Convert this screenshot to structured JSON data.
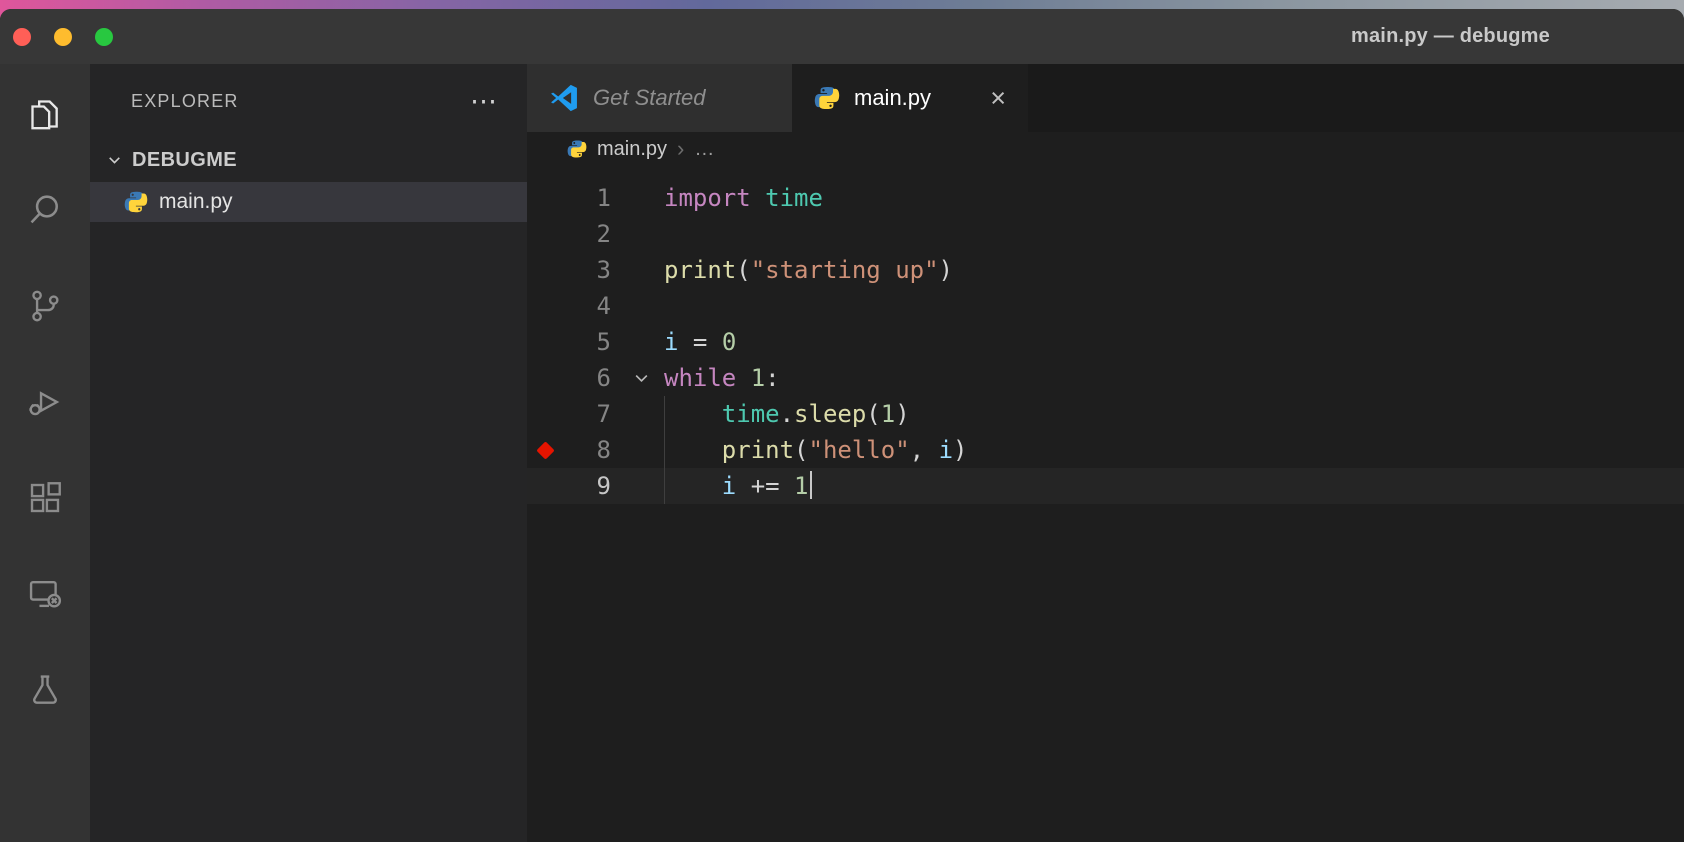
{
  "window": {
    "title": "main.py — debugme",
    "traffic_lights": {
      "close": "#ff5f57",
      "minimize": "#febc2e",
      "zoom": "#28c840"
    }
  },
  "activity_bar": {
    "items": [
      {
        "id": "explorer",
        "icon": "files-icon",
        "active": true
      },
      {
        "id": "search",
        "icon": "search-icon",
        "active": false
      },
      {
        "id": "source-control",
        "icon": "git-branch-icon",
        "active": false
      },
      {
        "id": "run-and-debug",
        "icon": "debug-play-icon",
        "active": false
      },
      {
        "id": "extensions",
        "icon": "extensions-icon",
        "active": false
      },
      {
        "id": "remote-explorer",
        "icon": "remote-monitor-icon",
        "active": false
      },
      {
        "id": "testing",
        "icon": "flask-icon",
        "active": false
      }
    ]
  },
  "sidebar": {
    "title": "EXPLORER",
    "more_actions": "⋯",
    "section": {
      "label": "DEBUGME",
      "expanded": true
    },
    "files": [
      {
        "name": "main.py",
        "icon": "python-icon",
        "selected": true
      }
    ]
  },
  "tabs": [
    {
      "label": "Get Started",
      "icon": "vscode-logo-icon",
      "active": false
    },
    {
      "label": "main.py",
      "icon": "python-icon",
      "active": true,
      "close": "×"
    }
  ],
  "breadcrumb": {
    "file": "main.py",
    "separator": "›",
    "tail": "…"
  },
  "editor": {
    "language": "python",
    "token_colors": {
      "keyword": "#c586c0",
      "module": "#4ec9b0",
      "function": "#dcdcaa",
      "string": "#ce9178",
      "number": "#b5cea8",
      "variable": "#9cdcfe",
      "punct": "#d4d4d4",
      "breakpoint": "#e51400"
    },
    "lines": [
      {
        "num": 1,
        "tokens": [
          [
            "keyword",
            "import"
          ],
          [
            "punct",
            " "
          ],
          [
            "module",
            "time"
          ]
        ]
      },
      {
        "num": 2,
        "tokens": []
      },
      {
        "num": 3,
        "tokens": [
          [
            "function",
            "print"
          ],
          [
            "punct",
            "("
          ],
          [
            "string",
            "\"starting up\""
          ],
          [
            "punct",
            ")"
          ]
        ]
      },
      {
        "num": 4,
        "tokens": []
      },
      {
        "num": 5,
        "tokens": [
          [
            "variable",
            "i"
          ],
          [
            "punct",
            " = "
          ],
          [
            "number",
            "0"
          ]
        ]
      },
      {
        "num": 6,
        "tokens": [
          [
            "keyword",
            "while"
          ],
          [
            "punct",
            " "
          ],
          [
            "number",
            "1"
          ],
          [
            "punct",
            ":"
          ]
        ],
        "fold": true
      },
      {
        "num": 7,
        "tokens": [
          [
            "punct",
            "    "
          ],
          [
            "module",
            "time"
          ],
          [
            "punct",
            "."
          ],
          [
            "function",
            "sleep"
          ],
          [
            "punct",
            "("
          ],
          [
            "number",
            "1"
          ],
          [
            "punct",
            ")"
          ]
        ],
        "indent_guide": true
      },
      {
        "num": 8,
        "tokens": [
          [
            "punct",
            "    "
          ],
          [
            "function",
            "print"
          ],
          [
            "punct",
            "("
          ],
          [
            "string",
            "\"hello\""
          ],
          [
            "punct",
            ", "
          ],
          [
            "variable",
            "i"
          ],
          [
            "punct",
            ")"
          ]
        ],
        "breakpoint": true,
        "indent_guide": true
      },
      {
        "num": 9,
        "tokens": [
          [
            "punct",
            "    "
          ],
          [
            "variable",
            "i"
          ],
          [
            "punct",
            " += "
          ],
          [
            "number",
            "1"
          ]
        ],
        "cursor": true,
        "active": true,
        "indent_guide": true
      }
    ]
  }
}
